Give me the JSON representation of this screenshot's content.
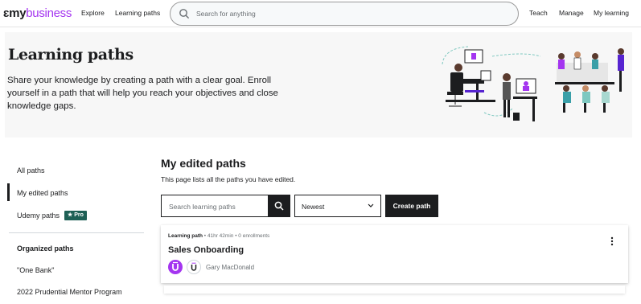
{
  "header": {
    "logo_udemy": "ɛmy",
    "logo_business": "business",
    "nav_explore": "Explore",
    "nav_learning_paths": "Learning paths",
    "search_placeholder": "Search for anything",
    "nav_teach": "Teach",
    "nav_manage": "Manage",
    "nav_my_learning": "My learning"
  },
  "banner": {
    "title": "Learning paths",
    "description": "Share your knowledge by creating a path with a clear goal. Enroll yourself in a path that will help you reach your objectives and close knowledge gaps."
  },
  "sidebar": {
    "items": [
      {
        "label": "All paths"
      },
      {
        "label": "My edited paths",
        "active": true
      },
      {
        "label": "Udemy paths",
        "badge": "★ Pro"
      }
    ],
    "organized_heading": "Organized paths",
    "organized_items": [
      {
        "label": "\"One Bank\""
      },
      {
        "label": "2022 Prudential Mentor Program"
      }
    ]
  },
  "main": {
    "title": "My edited paths",
    "subtitle": "This page lists all the paths you have edited.",
    "search_placeholder": "Search learning paths",
    "sort_selected": "Newest",
    "create_button": "Create path",
    "card": {
      "type_label": "Learning path",
      "details": " • 41hr 42min • 0 enrollments",
      "title": "Sales Onboarding",
      "author": "Gary MacDonald"
    }
  },
  "colors": {
    "brand_purple": "#a435f0",
    "pro_badge": "#1e6055",
    "dark": "#1c1d1f",
    "banner_bg": "#f7f7f7"
  }
}
